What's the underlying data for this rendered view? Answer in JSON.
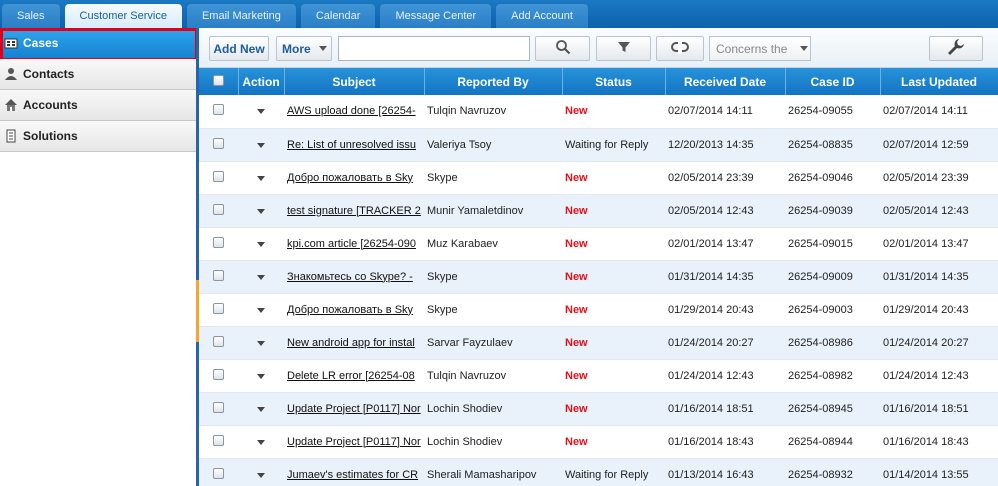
{
  "nav_tabs": [
    {
      "label": "Sales",
      "active": false
    },
    {
      "label": "Customer Service",
      "active": true
    },
    {
      "label": "Email Marketing",
      "active": false
    },
    {
      "label": "Calendar",
      "active": false
    },
    {
      "label": "Message Center",
      "active": false
    },
    {
      "label": "Add Account",
      "active": false
    }
  ],
  "sidebar": {
    "items": [
      {
        "label": "Cases",
        "icon": "cases-icon",
        "active": true
      },
      {
        "label": "Contacts",
        "icon": "contacts-icon",
        "active": false
      },
      {
        "label": "Accounts",
        "icon": "accounts-icon",
        "active": false
      },
      {
        "label": "Solutions",
        "icon": "solutions-icon",
        "active": false
      }
    ]
  },
  "toolbar": {
    "add_new_label": "Add New",
    "more_label": "More",
    "search_value": "",
    "search_icon": "magnifier-icon",
    "filter_icon": "funnel-icon",
    "refresh_icon": "refresh-icon",
    "filter_select_value": "Concerns the",
    "settings_icon": "wrench-icon"
  },
  "table": {
    "columns": [
      "",
      "Action",
      "Subject",
      "Reported By",
      "Status",
      "Received Date",
      "Case ID",
      "Last Updated"
    ],
    "rows": [
      {
        "subject": "AWS upload done [26254-",
        "reported_by": "Tulqin Navruzov",
        "status": "New",
        "received": "02/07/2014 14:11",
        "case_id": "26254-09055",
        "updated": "02/07/2014 14:11"
      },
      {
        "subject": "Re: List of unresolved issu",
        "reported_by": "Valeriya Tsoy",
        "status": "Waiting for Reply",
        "received": "12/20/2013 14:35",
        "case_id": "26254-08835",
        "updated": "02/07/2014 12:59"
      },
      {
        "subject": "Добро пожаловать в Sky",
        "reported_by": "Skype",
        "status": "New",
        "received": "02/05/2014 23:39",
        "case_id": "26254-09046",
        "updated": "02/05/2014 23:39"
      },
      {
        "subject": "test signature [TRACKER 2",
        "reported_by": "Munir Yamaletdinov",
        "status": "New",
        "received": "02/05/2014 12:43",
        "case_id": "26254-09039",
        "updated": "02/05/2014 12:43"
      },
      {
        "subject": "kpi.com article [26254-090",
        "reported_by": "Muz Karabaev",
        "status": "New",
        "received": "02/01/2014 13:47",
        "case_id": "26254-09015",
        "updated": "02/01/2014 13:47"
      },
      {
        "subject": "Знакомьтесь со Skype? -",
        "reported_by": "Skype",
        "status": "New",
        "received": "01/31/2014 14:35",
        "case_id": "26254-09009",
        "updated": "01/31/2014 14:35"
      },
      {
        "subject": "Добро пожаловать в Sky",
        "reported_by": "Skype",
        "status": "New",
        "received": "01/29/2014 20:43",
        "case_id": "26254-09003",
        "updated": "01/29/2014 20:43"
      },
      {
        "subject": "New android app for instal",
        "reported_by": "Sarvar Fayzulaev",
        "status": "New",
        "received": "01/24/2014 20:27",
        "case_id": "26254-08986",
        "updated": "01/24/2014 20:27"
      },
      {
        "subject": "Delete LR error [26254-08",
        "reported_by": "Tulqin Navruzov",
        "status": "New",
        "received": "01/24/2014 12:43",
        "case_id": "26254-08982",
        "updated": "01/24/2014 12:43"
      },
      {
        "subject": "Update Project [P0117] Nor",
        "reported_by": "Lochin Shodiev",
        "status": "New",
        "received": "01/16/2014 18:51",
        "case_id": "26254-08945",
        "updated": "01/16/2014 18:51"
      },
      {
        "subject": "Update Project [P0117] Nor",
        "reported_by": "Lochin Shodiev",
        "status": "New",
        "received": "01/16/2014 18:43",
        "case_id": "26254-08944",
        "updated": "01/16/2014 18:43"
      },
      {
        "subject": "Jumaev's estimates for CR",
        "reported_by": "Sherali Mamasharipov",
        "status": "Waiting for Reply",
        "received": "01/13/2014 16:43",
        "case_id": "26254-08932",
        "updated": "01/14/2014 13:55"
      }
    ]
  },
  "colors": {
    "accent": "#1681d0",
    "status_new": "#e2111a",
    "highlight_outline": "#e1001a"
  }
}
